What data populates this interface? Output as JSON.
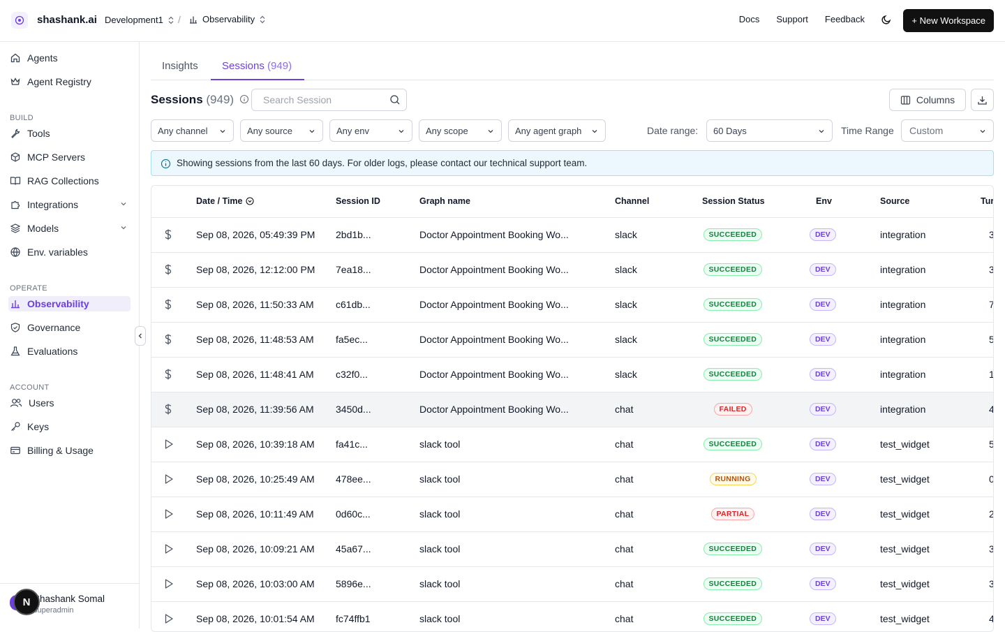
{
  "header": {
    "brand": "shashank.ai",
    "workspace": "Development1",
    "section": "Observability",
    "links": [
      "Docs",
      "Support",
      "Feedback"
    ],
    "new_workspace": "+ New Workspace"
  },
  "sidebar": {
    "top_items": [
      {
        "label": "Agents",
        "icon": "home-icon"
      },
      {
        "label": "Agent Registry",
        "icon": "crown-icon"
      }
    ],
    "build_label": "BUILD",
    "build_items": [
      {
        "label": "Tools",
        "icon": "wrench-icon"
      },
      {
        "label": "MCP Servers",
        "icon": "cube-icon"
      },
      {
        "label": "RAG Collections",
        "icon": "book-icon"
      },
      {
        "label": "Integrations",
        "icon": "puzzle-icon"
      },
      {
        "label": "Models",
        "icon": "layers-icon"
      },
      {
        "label": "Env. variables",
        "icon": "globe-icon"
      }
    ],
    "operate_label": "OPERATE",
    "operate_items": [
      {
        "label": "Observability",
        "icon": "chart-icon"
      },
      {
        "label": "Governance",
        "icon": "shield-icon"
      },
      {
        "label": "Evaluations",
        "icon": "flask-icon"
      }
    ],
    "account_label": "ACCOUNT",
    "account_items": [
      {
        "label": "Users",
        "icon": "users-icon"
      },
      {
        "label": "Keys",
        "icon": "key-icon"
      },
      {
        "label": "Billing & Usage",
        "icon": "card-icon"
      }
    ],
    "user": {
      "name": "Shashank Somal",
      "role": "superadmin",
      "avatar_letter": "N"
    }
  },
  "tabs": {
    "insights": "Insights",
    "sessions": "Sessions",
    "sessions_count": "(949)"
  },
  "toolbar": {
    "title": "Sessions",
    "count": "(949)",
    "search_placeholder": "Search Session",
    "columns": "Columns"
  },
  "filters": {
    "channel": "Any channel",
    "source": "Any source",
    "env": "Any env",
    "scope": "Any scope",
    "agent_graph": "Any agent graph",
    "date_range_label": "Date range:",
    "date_range_value": "60 Days",
    "time_range_label": "Time Range",
    "time_range_value": "Custom"
  },
  "info": "Showing sessions from the last 60 days. For older logs, please contact our technical support team.",
  "table": {
    "headers": {
      "datetime": "Date / Time",
      "session_id": "Session ID",
      "graph": "Graph name",
      "channel": "Channel",
      "status": "Session Status",
      "env": "Env",
      "source": "Source",
      "turns": "Tur"
    },
    "rows": [
      {
        "icon": "dollar",
        "datetime": "Sep 08, 2026, 05:49:39 PM",
        "id": "2bd1b...",
        "graph": "Doctor Appointment Booking Wo...",
        "channel": "slack",
        "status": "SUCCEEDED",
        "env": "DEV",
        "source": "integration",
        "turns": "3"
      },
      {
        "icon": "dollar",
        "datetime": "Sep 08, 2026, 12:12:00 PM",
        "id": "7ea18...",
        "graph": "Doctor Appointment Booking Wo...",
        "channel": "slack",
        "status": "SUCCEEDED",
        "env": "DEV",
        "source": "integration",
        "turns": "3"
      },
      {
        "icon": "dollar",
        "datetime": "Sep 08, 2026, 11:50:33 AM",
        "id": "c61db...",
        "graph": "Doctor Appointment Booking Wo...",
        "channel": "slack",
        "status": "SUCCEEDED",
        "env": "DEV",
        "source": "integration",
        "turns": "7"
      },
      {
        "icon": "dollar",
        "datetime": "Sep 08, 2026, 11:48:53 AM",
        "id": "fa5ec...",
        "graph": "Doctor Appointment Booking Wo...",
        "channel": "slack",
        "status": "SUCCEEDED",
        "env": "DEV",
        "source": "integration",
        "turns": "5"
      },
      {
        "icon": "dollar",
        "datetime": "Sep 08, 2026, 11:48:41 AM",
        "id": "c32f0...",
        "graph": "Doctor Appointment Booking Wo...",
        "channel": "slack",
        "status": "SUCCEEDED",
        "env": "DEV",
        "source": "integration",
        "turns": "1"
      },
      {
        "icon": "dollar",
        "datetime": "Sep 08, 2026, 11:39:56 AM",
        "id": "3450d...",
        "graph": "Doctor Appointment Booking Wo...",
        "channel": "chat",
        "status": "FAILED",
        "env": "DEV",
        "source": "integration",
        "turns": "4",
        "highlight": true
      },
      {
        "icon": "play",
        "datetime": "Sep 08, 2026, 10:39:18 AM",
        "id": "fa41c...",
        "graph": "slack tool",
        "channel": "chat",
        "status": "SUCCEEDED",
        "env": "DEV",
        "source": "test_widget",
        "turns": "5"
      },
      {
        "icon": "play",
        "datetime": "Sep 08, 2026, 10:25:49 AM",
        "id": "478ee...",
        "graph": "slack tool",
        "channel": "chat",
        "status": "RUNNING",
        "env": "DEV",
        "source": "test_widget",
        "turns": "0"
      },
      {
        "icon": "play",
        "datetime": "Sep 08, 2026, 10:11:49 AM",
        "id": "0d60c...",
        "graph": "slack tool",
        "channel": "chat",
        "status": "PARTIAL",
        "env": "DEV",
        "source": "test_widget",
        "turns": "2"
      },
      {
        "icon": "play",
        "datetime": "Sep 08, 2026, 10:09:21 AM",
        "id": "45a67...",
        "graph": "slack tool",
        "channel": "chat",
        "status": "SUCCEEDED",
        "env": "DEV",
        "source": "test_widget",
        "turns": "3"
      },
      {
        "icon": "play",
        "datetime": "Sep 08, 2026, 10:03:00 AM",
        "id": "5896e...",
        "graph": "slack tool",
        "channel": "chat",
        "status": "SUCCEEDED",
        "env": "DEV",
        "source": "test_widget",
        "turns": "3"
      },
      {
        "icon": "play",
        "datetime": "Sep 08, 2026, 10:01:54 AM",
        "id": "fc74ffb1",
        "graph": "slack tool",
        "channel": "chat",
        "status": "SUCCEEDED",
        "env": "DEV",
        "source": "test_widget",
        "turns": "4"
      }
    ]
  }
}
